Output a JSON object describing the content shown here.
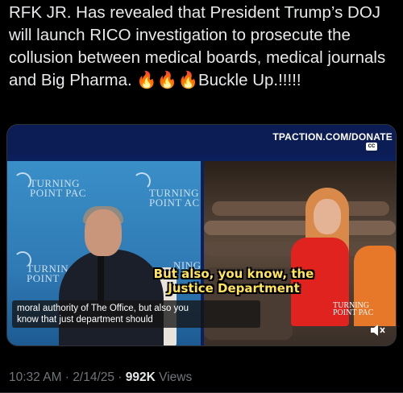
{
  "post": {
    "text_part1": "RFK JR. Has revealed that President Trump’s DOJ will launch RICO investigation to prosecute the collusion between medical boards, medical journals and Big Pharma. ",
    "fire_emojis": "🔥🔥🔥",
    "text_part2": "Buckle Up.!!!!!"
  },
  "video": {
    "banner_url": "TPACTION.COM/DONATE",
    "cc_label": "CC",
    "logo_line1": "TURNING",
    "logo_line2": "POINT PAC",
    "logo_line2_alt": "POINT AC",
    "logo_line1_short": "TURNIN",
    "logo_line2_short": "POINT A",
    "logo_line1_right": "NING",
    "subtitle_line1": "But also, you know, the",
    "subtitle_line2": "Justice Department",
    "caption_line1": "moral authority of The Office, but also you",
    "caption_line2": "know that just department should",
    "corner_logo_line1": "TURNING",
    "corner_logo_line2": "POINT PAC",
    "mute_icon": "speaker-muted-icon"
  },
  "meta": {
    "time": "10:32 AM",
    "sep1": " · ",
    "date": "2/14/25",
    "sep2": " · ",
    "views_count": "992K",
    "views_label": " Views"
  }
}
